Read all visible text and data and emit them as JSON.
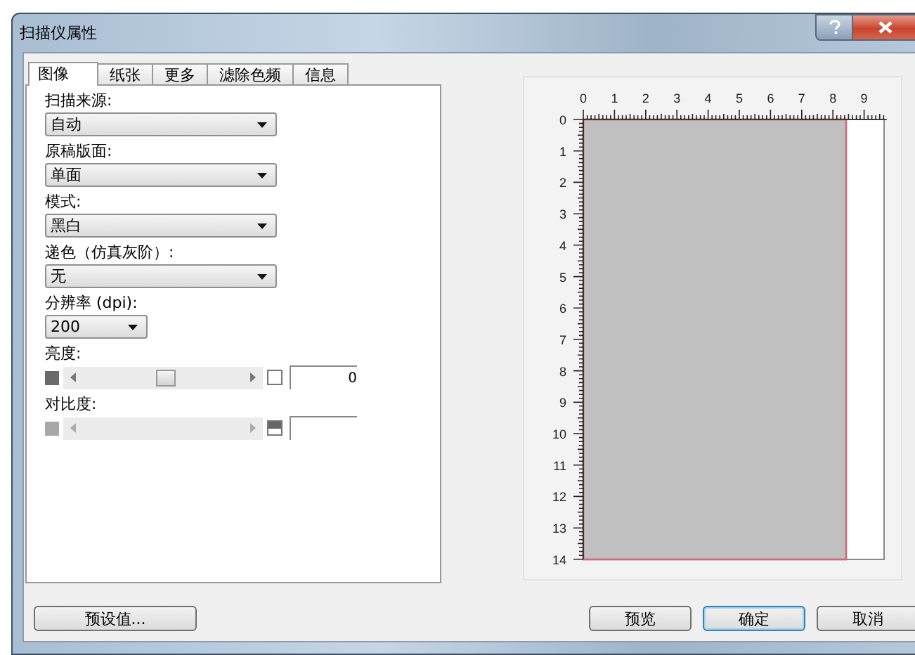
{
  "window": {
    "title": "扫描仪属性"
  },
  "tabs": [
    {
      "label": "图像",
      "selected": true
    },
    {
      "label": "纸张",
      "selected": false
    },
    {
      "label": "更多",
      "selected": false
    },
    {
      "label": "滤除色频",
      "selected": false
    },
    {
      "label": "信息",
      "selected": false
    }
  ],
  "fields": [
    {
      "kind": "dropdown",
      "label": "扫描来源:",
      "value": "自动",
      "wide": true
    },
    {
      "kind": "dropdown",
      "label": "原稿版面:",
      "value": "单面",
      "wide": true
    },
    {
      "kind": "dropdown",
      "label": "模式:",
      "value": "黑白",
      "wide": true
    },
    {
      "kind": "dropdown",
      "label": "递色（仿真灰阶）:",
      "value": "无",
      "wide": true
    },
    {
      "kind": "dropdown",
      "label": "分辨率 (dpi):",
      "value": "200",
      "wide": false
    },
    {
      "kind": "slider",
      "label": "亮度:",
      "level": 0.5,
      "value": "0",
      "disabled": false
    },
    {
      "kind": "slider",
      "label": "对比度:",
      "disabled": true
    }
  ],
  "preview": {
    "x_ruler": [
      "0",
      "1",
      "2",
      "3",
      "4",
      "5",
      "6",
      "7",
      "8",
      "9"
    ],
    "y_ruler": [
      "0",
      "1",
      "2",
      "3",
      "4",
      "5",
      "6",
      "7",
      "8",
      "9",
      "10",
      "11",
      "12",
      "13",
      "14"
    ]
  },
  "buttons": [
    {
      "label": "预设值...",
      "default": false
    },
    {
      "label": "预览",
      "default": false
    },
    {
      "label": "确定",
      "default": true
    },
    {
      "label": "取消",
      "default": false
    }
  ]
}
